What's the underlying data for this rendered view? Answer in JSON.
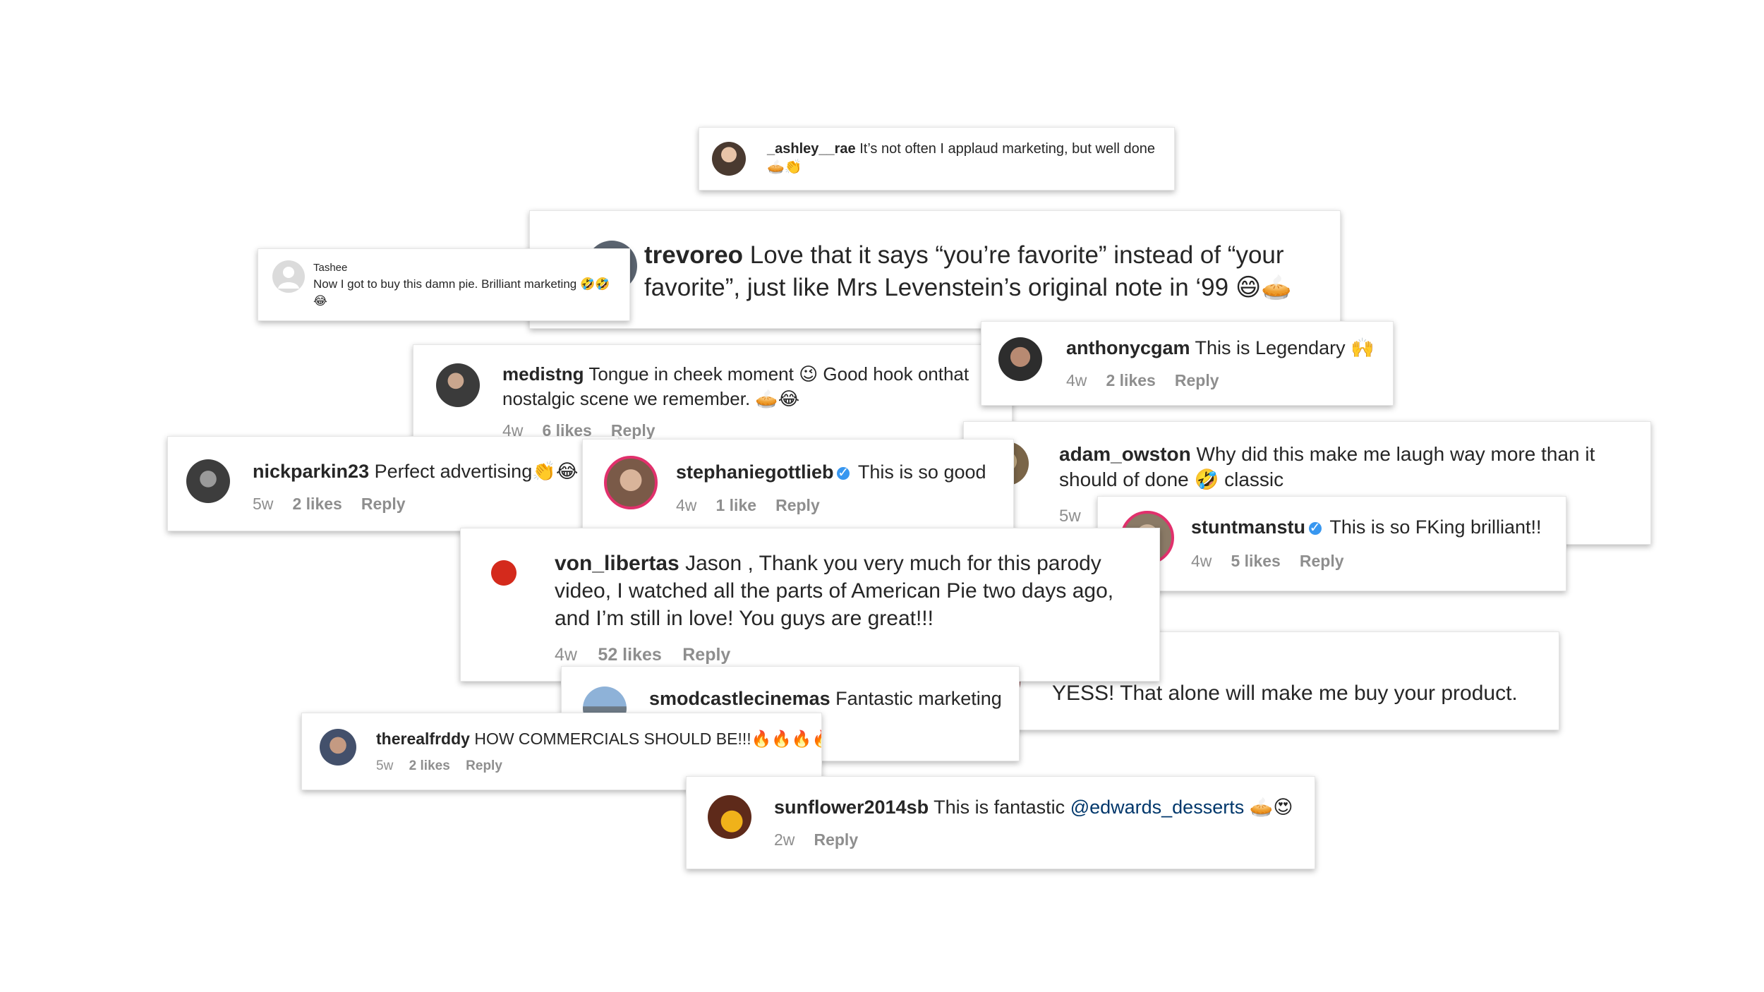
{
  "comments": [
    {
      "user": "_ashley__rae",
      "text": "It’s not often I applaud marketing, but well done 🥧👏"
    },
    {
      "user": "trevoreo",
      "text": "Love that it says “you’re favorite” instead of “your favorite”, just like Mrs Levenstein’s original note in ‘99 😄🥧"
    },
    {
      "user": "Tashee",
      "text": "Now I got to buy this damn pie. Brilliant marketing 🤣🤣😂"
    },
    {
      "user": "medistng",
      "text": "Tongue in cheek moment 😉 Good hook onthat nostalgic scene we remember. 🥧😂",
      "time": "4w",
      "likes": "6 likes",
      "reply": "Reply"
    },
    {
      "user": "anthonycgam",
      "text": "This is Legendary 🙌",
      "time": "4w",
      "likes": "2 likes",
      "reply": "Reply"
    },
    {
      "user": "nickparkin23",
      "text": "Perfect advertising👏😂",
      "time": "5w",
      "likes": "2 likes",
      "reply": "Reply"
    },
    {
      "user": "stephaniegottlieb",
      "verified_mark": "✓",
      "text": "This is so good",
      "time": "4w",
      "likes": "1 like",
      "reply": "Reply"
    },
    {
      "user": "adam_owston",
      "text": "Why did this make me laugh way more than it should of done 🤣 classic",
      "time": "5w"
    },
    {
      "user": "stuntmanstu",
      "verified_mark": "✓",
      "text": "This is so FKing brilliant!!",
      "time": "4w",
      "likes": "5 likes",
      "reply": "Reply"
    },
    {
      "user": "von_libertas",
      "text": "Jason , Thank you very much for this parody video, I watched all the parts of American Pie two days ago, and I’m still in love! You guys are great!!!",
      "time": "4w",
      "likes": "52 likes",
      "reply": "Reply"
    },
    {
      "text": "YESS! That alone will make me buy your product."
    },
    {
      "user": "smodcastlecinemas",
      "text": "Fantastic marketing"
    },
    {
      "user": "therealfrddy",
      "text": "HOW COMMERCIALS SHOULD BE!!!🔥🔥🔥🔥",
      "time": "5w",
      "likes": "2 likes",
      "reply": "Reply"
    },
    {
      "user": "sunflower2014sb",
      "text": "This is fantastic",
      "mention": "@edwards_desserts",
      "text_end": "🥧😍",
      "time": "2w",
      "reply": "Reply"
    }
  ]
}
